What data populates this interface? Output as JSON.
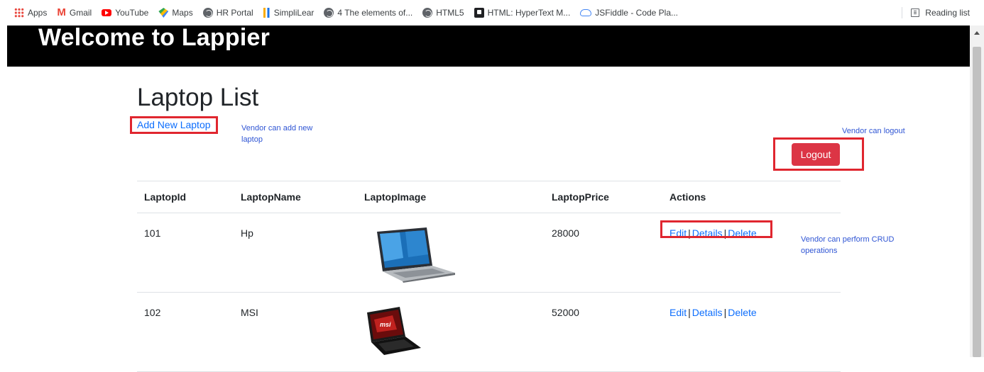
{
  "bookmarks": [
    {
      "label": "Apps",
      "icon": "apps-icon"
    },
    {
      "label": "Gmail",
      "icon": "gmail-icon"
    },
    {
      "label": "YouTube",
      "icon": "youtube-icon"
    },
    {
      "label": "Maps",
      "icon": "maps-icon"
    },
    {
      "label": "HR Portal",
      "icon": "globe-icon"
    },
    {
      "label": "SimpliLear",
      "icon": "simplilearn-icon"
    },
    {
      "label": "4 The elements of...",
      "icon": "globe-icon"
    },
    {
      "label": "HTML5",
      "icon": "globe-icon"
    },
    {
      "label": "HTML: HyperText M...",
      "icon": "mdn-icon"
    },
    {
      "label": "JSFiddle - Code Pla...",
      "icon": "cloud-icon"
    }
  ],
  "reading_list_label": "Reading list",
  "banner": {
    "title": "Welcome to Lappier"
  },
  "page": {
    "title": "Laptop List",
    "add_link": "Add New Laptop",
    "logout_label": "Logout"
  },
  "notes": {
    "add": "Vendor can add new laptop",
    "logout": "Vendor can logout",
    "crud": "Vendor can perform CRUD operations"
  },
  "table": {
    "headers": [
      "LaptopId",
      "LaptopName",
      "LaptopImage",
      "LaptopPrice",
      "Actions"
    ],
    "rows": [
      {
        "id": "101",
        "name": "Hp",
        "image": "hp-laptop-image",
        "price": "28000"
      },
      {
        "id": "102",
        "name": "MSI",
        "image": "msi-laptop-image",
        "price": "52000"
      }
    ],
    "actions": {
      "edit": "Edit",
      "details": "Details",
      "delete": "Delete",
      "separator": "|"
    }
  },
  "colors": {
    "banner_bg": "#000000",
    "link": "#0d6efd",
    "danger": "#dc3545",
    "highlight": "#e0262f",
    "note": "#2f55d4"
  }
}
